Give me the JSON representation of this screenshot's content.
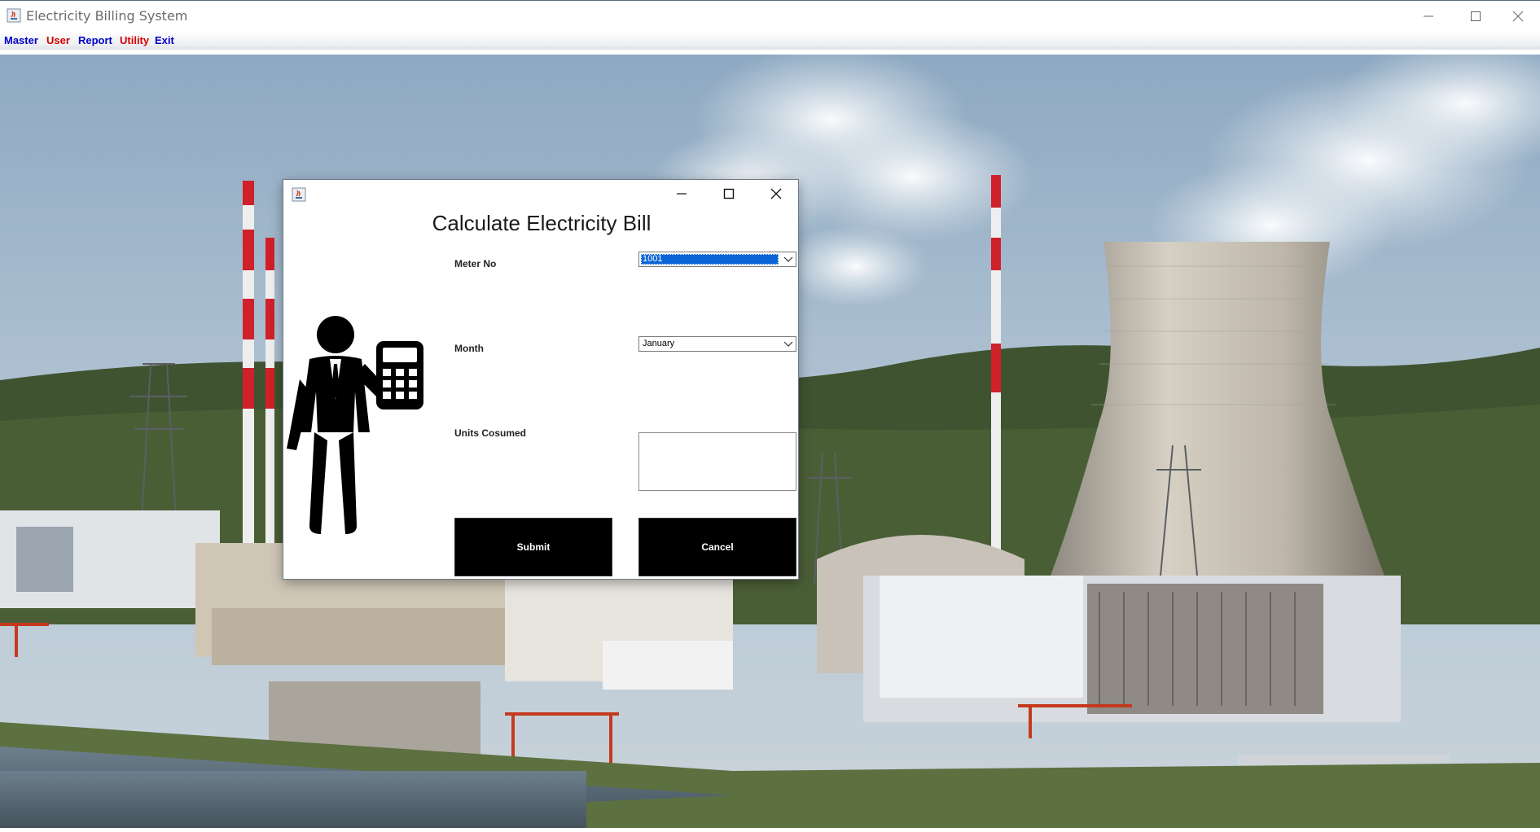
{
  "app": {
    "title": "Electricity Billing System"
  },
  "menu": [
    {
      "label": "Master",
      "color": "#0000c8"
    },
    {
      "label": "User",
      "color": "#d40000"
    },
    {
      "label": "Report",
      "color": "#0000c8"
    },
    {
      "label": "Utility",
      "color": "#d40000"
    },
    {
      "label": "Exit",
      "color": "#0000c8"
    }
  ],
  "dialog": {
    "heading": "Calculate Electricity Bill",
    "meter_label": "Meter No",
    "meter_value": "1001",
    "month_label": "Month",
    "month_value": "January",
    "units_label": "Units Cosumed",
    "units_value": "",
    "submit_label": "Submit",
    "cancel_label": "Cancel"
  },
  "icons": [
    "java-app-icon",
    "minimize-icon",
    "maximize-icon",
    "close-icon",
    "chevron-down-icon",
    "clerk-with-calculator-icon"
  ],
  "colors": {
    "button_bg": "#000000",
    "button_text": "#ffffff",
    "selection": "#0a64d6"
  }
}
